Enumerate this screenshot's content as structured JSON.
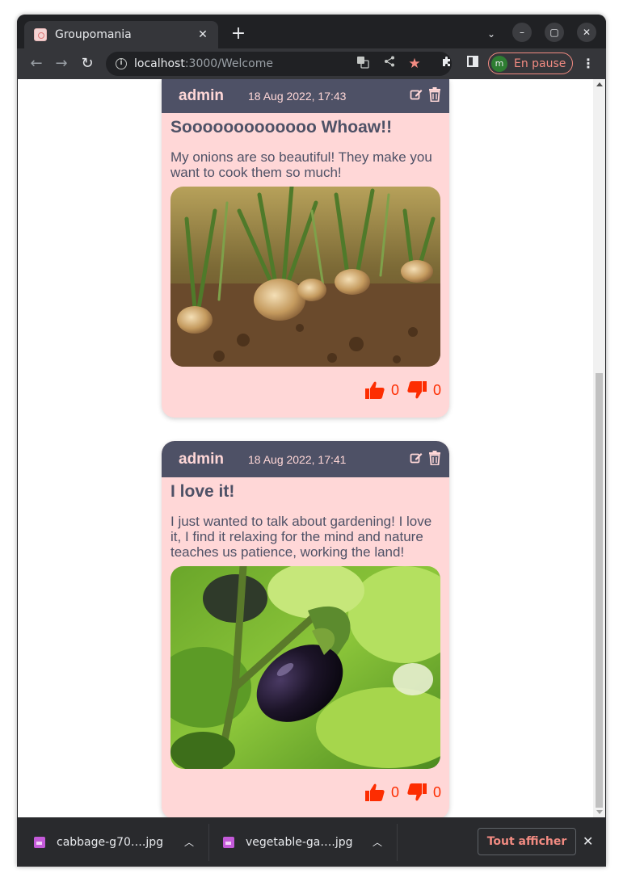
{
  "browser": {
    "tab": {
      "title": "Groupomania",
      "close": "✕"
    },
    "new_tab": "+",
    "tab_search": "⌄",
    "window_controls": {
      "minimize": "–",
      "maximize": "▢",
      "close": "✕"
    },
    "nav": {
      "back": "←",
      "forward": "→",
      "reload": "↻"
    },
    "url": {
      "host": "localhost",
      "path": ":3000/Welcome"
    },
    "profile": {
      "initial": "m",
      "label": "En pause"
    },
    "menu": "⋮"
  },
  "posts": [
    {
      "author": "admin",
      "date": "18 Aug 2022, 17:43",
      "title": "Sooooooooooooo Whoaw!!",
      "body": "My onions are so beautiful! They make you want to cook them so much!",
      "likes": "0",
      "dislikes": "0",
      "image_subject": "onions growing in soil"
    },
    {
      "author": "admin",
      "date": "18 Aug 2022, 17:41",
      "title": "I love it!",
      "body": "I just wanted to talk about gardening! I love it, I find it relaxing for the mind and nature teaches us patience, working the land!",
      "likes": "0",
      "dislikes": "0",
      "image_subject": "eggplant on the plant"
    }
  ],
  "downloads": {
    "items": [
      {
        "name": "cabbage-g70….jpg"
      },
      {
        "name": "vegetable-ga….jpg"
      }
    ],
    "show_all": "Tout afficher",
    "close": "✕"
  },
  "colors": {
    "card_bg": "#ffd7d7",
    "header_bg": "#4e5166",
    "vote_red": "#fd2d01"
  }
}
